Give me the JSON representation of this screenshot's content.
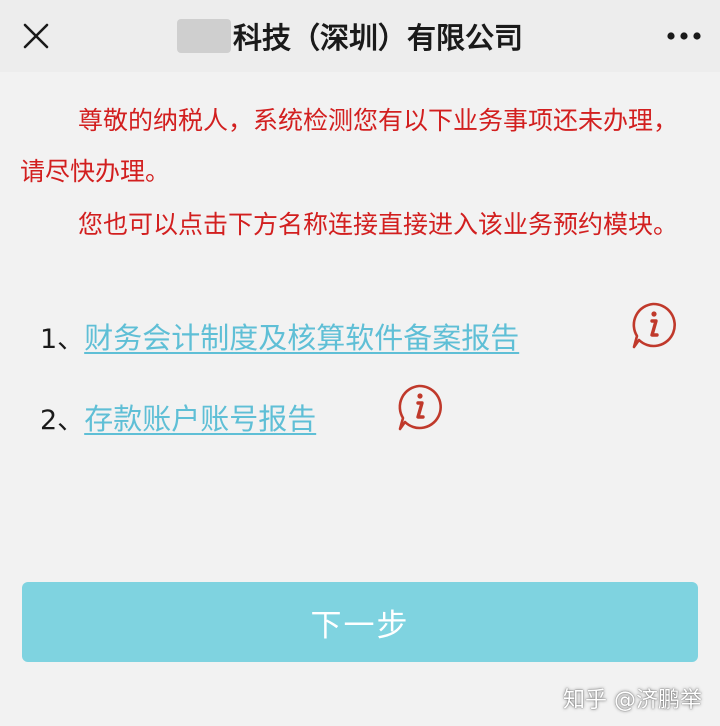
{
  "header": {
    "title": "科技（深圳）有限公司",
    "close_icon": "close-icon",
    "more_icon": "more-dots-icon"
  },
  "notice": {
    "paragraph1": "尊敬的纳税人，系统检测您有以下业务事项还未办理，请尽快办理。",
    "paragraph2": "您也可以点击下方名称连接直接进入该业务预约模块。",
    "color": "#d21f1f"
  },
  "items": [
    {
      "number": "1、",
      "label": "财务会计制度及核算软件备案报告",
      "icon": "info-icon"
    },
    {
      "number": "2、",
      "label": "存款账户账号报告",
      "icon": "info-icon"
    }
  ],
  "next_button": {
    "label": "下一步",
    "color": "#7fd3e0"
  },
  "watermark": {
    "text": "知乎 @济鹏举"
  },
  "colors": {
    "link": "#5fbfd6",
    "info_icon": "#c0392b",
    "background": "#f2f2f2"
  }
}
